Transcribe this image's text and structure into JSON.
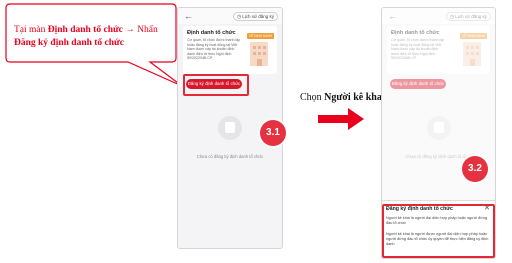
{
  "callout": {
    "prefix": "Tại màn ",
    "screen_name": "Định danh tổ chức",
    "arrow": " → Nhấn ",
    "action": "Đăng ký định danh tổ chức"
  },
  "transition": {
    "prefix": "Chọn ",
    "choice": "Người kê khai"
  },
  "screen": {
    "history_link": "Lịch sử đăng ký",
    "card_title": "Định danh tổ chức",
    "card_desc": "Cơ quan, tổ chức được thành lập hoặc đăng ký hoạt động tại Việt Nam được cấp tài khoản định danh điện tử theo Nghị định 59/2022/NĐ-CP",
    "verified_tag": "VỀ ĐỊNH DANH",
    "register_button": "Đăng ký định danh tổ chức",
    "empty_state": "Chưa có đăng ký định danh tổ chức"
  },
  "sheet": {
    "title": "Đăng ký định danh tổ chức",
    "option_1": "Người kê khai là người đại diện hợp pháp hoặc người đứng đầu tổ chức",
    "option_2": "Người kê khai là người được người đại diện hợp pháp hoặc người đứng đầu tổ chức ủy quyền để thực hiện đăng ký định danh"
  },
  "steps": {
    "step_1": "3.1",
    "step_2": "3.2"
  },
  "colors": {
    "accent_red": "#d7172b",
    "badge_red": "#e63140",
    "callout_text": "#e8001c"
  }
}
